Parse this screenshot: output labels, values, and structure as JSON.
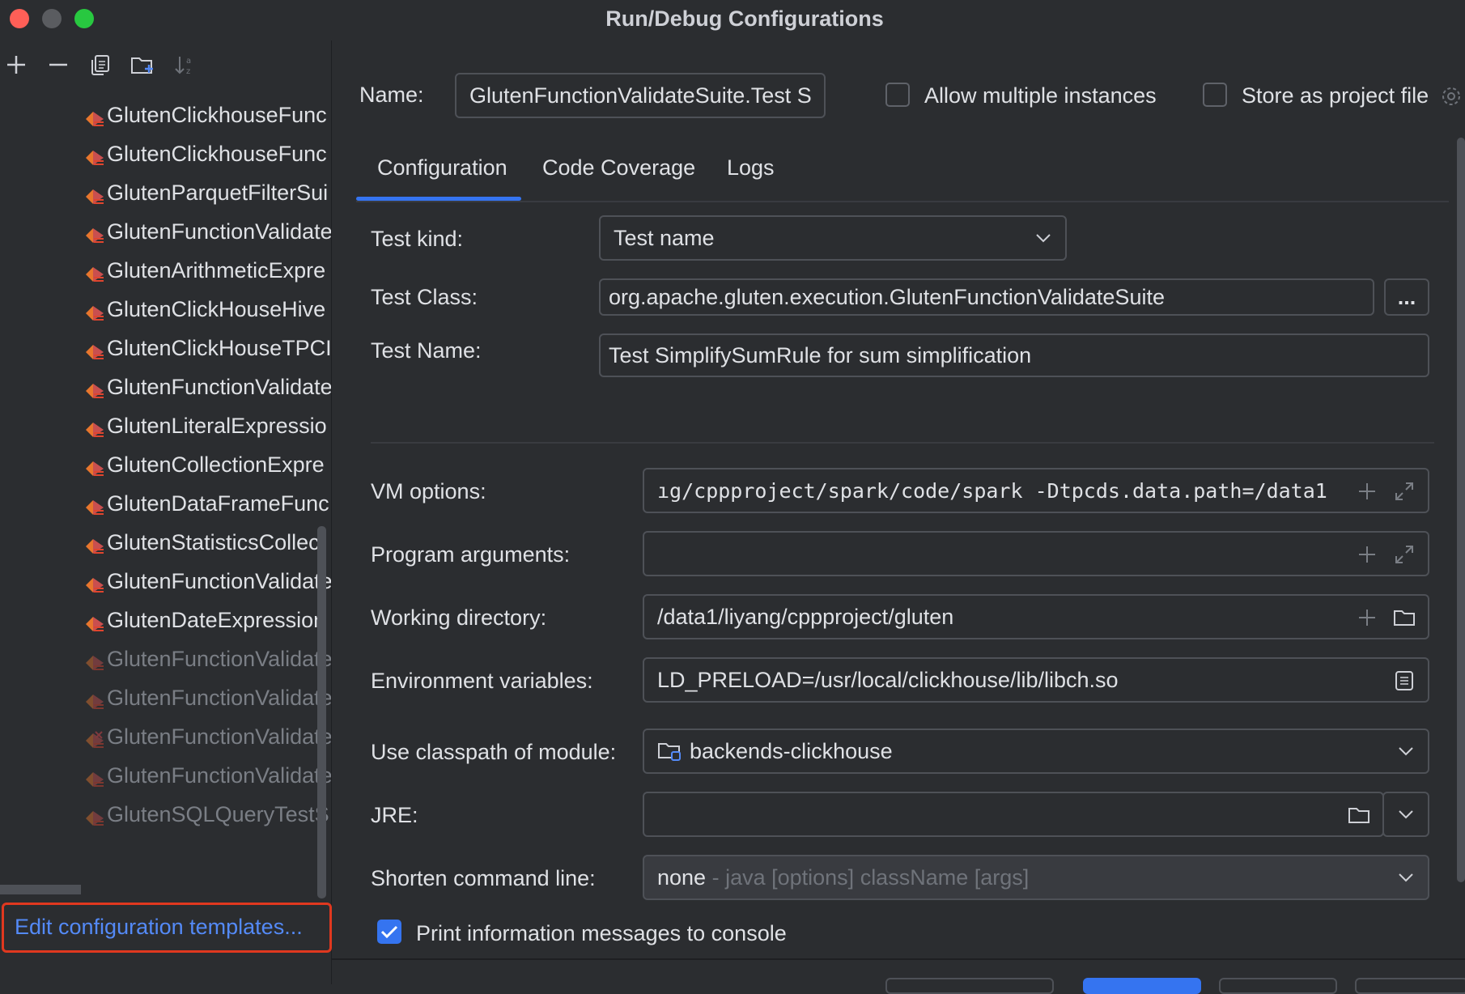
{
  "window": {
    "title": "Run/Debug Configurations"
  },
  "colors": {
    "accent": "#3574f0",
    "highlight_box": "#e0381f",
    "link": "#548af7"
  },
  "toolbar": {
    "icons": [
      "add-icon",
      "remove-icon",
      "copy-icon",
      "new-folder-icon",
      "sort-icon"
    ]
  },
  "tree": {
    "items": [
      {
        "label": "GlutenClickhouseFunc",
        "dim": false
      },
      {
        "label": "GlutenClickhouseFunc",
        "dim": false
      },
      {
        "label": "GlutenParquetFilterSui",
        "dim": false
      },
      {
        "label": "GlutenFunctionValidate",
        "dim": false
      },
      {
        "label": "GlutenArithmeticExpre",
        "dim": false
      },
      {
        "label": "GlutenClickHouseHive",
        "dim": false
      },
      {
        "label": "GlutenClickHouseTPCI",
        "dim": false
      },
      {
        "label": "GlutenFunctionValidate",
        "dim": false
      },
      {
        "label": "GlutenLiteralExpressio",
        "dim": false
      },
      {
        "label": "GlutenCollectionExpre",
        "dim": false
      },
      {
        "label": "GlutenDataFrameFunc",
        "dim": false
      },
      {
        "label": "GlutenStatisticsCollect",
        "dim": false
      },
      {
        "label": "GlutenFunctionValidate",
        "dim": false
      },
      {
        "label": "GlutenDateExpression",
        "dim": false
      },
      {
        "label": "GlutenFunctionValidate",
        "dim": true
      },
      {
        "label": "GlutenFunctionValidate",
        "dim": true
      },
      {
        "label": "GlutenFunctionValidate",
        "dim": true,
        "error": true
      },
      {
        "label": "GlutenFunctionValidate",
        "dim": true
      },
      {
        "label": "GlutenSQLQueryTestS",
        "dim": true
      }
    ]
  },
  "footer_left": {
    "templates_link": "Edit configuration templates..."
  },
  "form": {
    "name_label": "Name:",
    "name_value": "GlutenFunctionValidateSuite.Test S",
    "allow_multiple_label": "Allow multiple instances",
    "allow_multiple_checked": false,
    "store_project_label": "Store as project file",
    "store_project_checked": false,
    "tabs": [
      "Configuration",
      "Code Coverage",
      "Logs"
    ],
    "active_tab": "Configuration",
    "test_kind_label": "Test kind:",
    "test_kind_value": "Test name",
    "test_class_label": "Test Class:",
    "test_class_value": "org.apache.gluten.execution.GlutenFunctionValidateSuite",
    "browse_label": "...",
    "test_name_label": "Test Name:",
    "test_name_value": "Test SimplifySumRule for sum simplification",
    "vm_options_label": "VM options:",
    "vm_options_value": "ıg/cppproject/spark/code/spark -Dtpcds.data.path=/data1",
    "program_args_label": "Program arguments:",
    "program_args_value": "",
    "working_dir_label": "Working directory:",
    "working_dir_value": "/data1/liyang/cppproject/gluten",
    "env_vars_label": "Environment variables:",
    "env_vars_value": "LD_PRELOAD=/usr/local/clickhouse/lib/libch.so",
    "classpath_label": "Use classpath of module:",
    "classpath_value": "backends-clickhouse",
    "jre_label": "JRE:",
    "jre_value": "",
    "shorten_label": "Shorten command line:",
    "shorten_value": "none",
    "shorten_hint": "- java [options] className [args]",
    "print_info_label": "Print information messages to console",
    "print_info_checked": true
  }
}
